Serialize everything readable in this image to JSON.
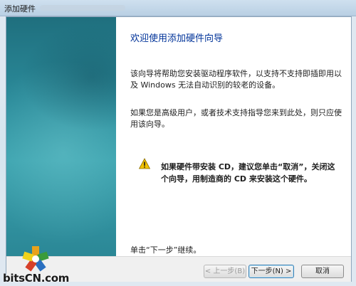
{
  "window": {
    "title": "添加硬件"
  },
  "wizard": {
    "heading": "欢迎使用添加硬件向导",
    "paragraph1": "该向导将帮助您安装驱动程序软件，以支持不支持即插即用以及 Windows 无法自动识别的较老的设备。",
    "paragraph2": "如果您是高级用户，或者技术支持指导您来到此处，则只应使用该向导。",
    "warning": "如果硬件带安装 CD，建议您单击“取消”，关闭这个向导，用制造商的 CD 来安装这个硬件。",
    "continue_hint": "单击“下一步”继续。"
  },
  "buttons": {
    "back": "< 上一步(B)",
    "next": "下一步(N) >",
    "cancel": "取消"
  },
  "logo": {
    "text": "bitsCN.com"
  },
  "colors": {
    "heading": "#003399",
    "side_panel": "#2b8b9a",
    "warning_icon": "#f2c200"
  },
  "icons": {
    "warning": "warning-icon"
  }
}
